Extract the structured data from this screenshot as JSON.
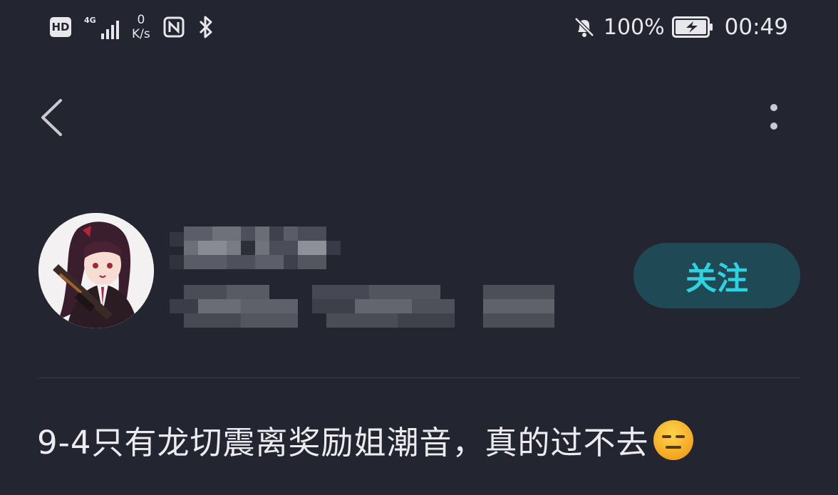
{
  "status_bar": {
    "hd_label": "HD",
    "network_label": "4G",
    "speed_value": "0",
    "speed_unit": "K/s",
    "battery_percent": "100%",
    "time": "00:49",
    "icons": [
      "hd-icon",
      "signal-icon",
      "nfc-icon",
      "bluetooth-icon",
      "mute-bell-icon",
      "battery-charging-icon"
    ]
  },
  "nav": {
    "back_icon": "chevron-left-icon",
    "more_icon": "more-vertical-icon"
  },
  "author": {
    "follow_label": "关注"
  },
  "post": {
    "title": "9-4只有龙切震离奖励姐潮音，真的过不去",
    "emoji_icon": "expressionless-face-icon"
  },
  "colors": {
    "background": "#232530",
    "accent": "#2fd3df",
    "follow_bg": "#1f4a55",
    "text": "#ececf0"
  }
}
